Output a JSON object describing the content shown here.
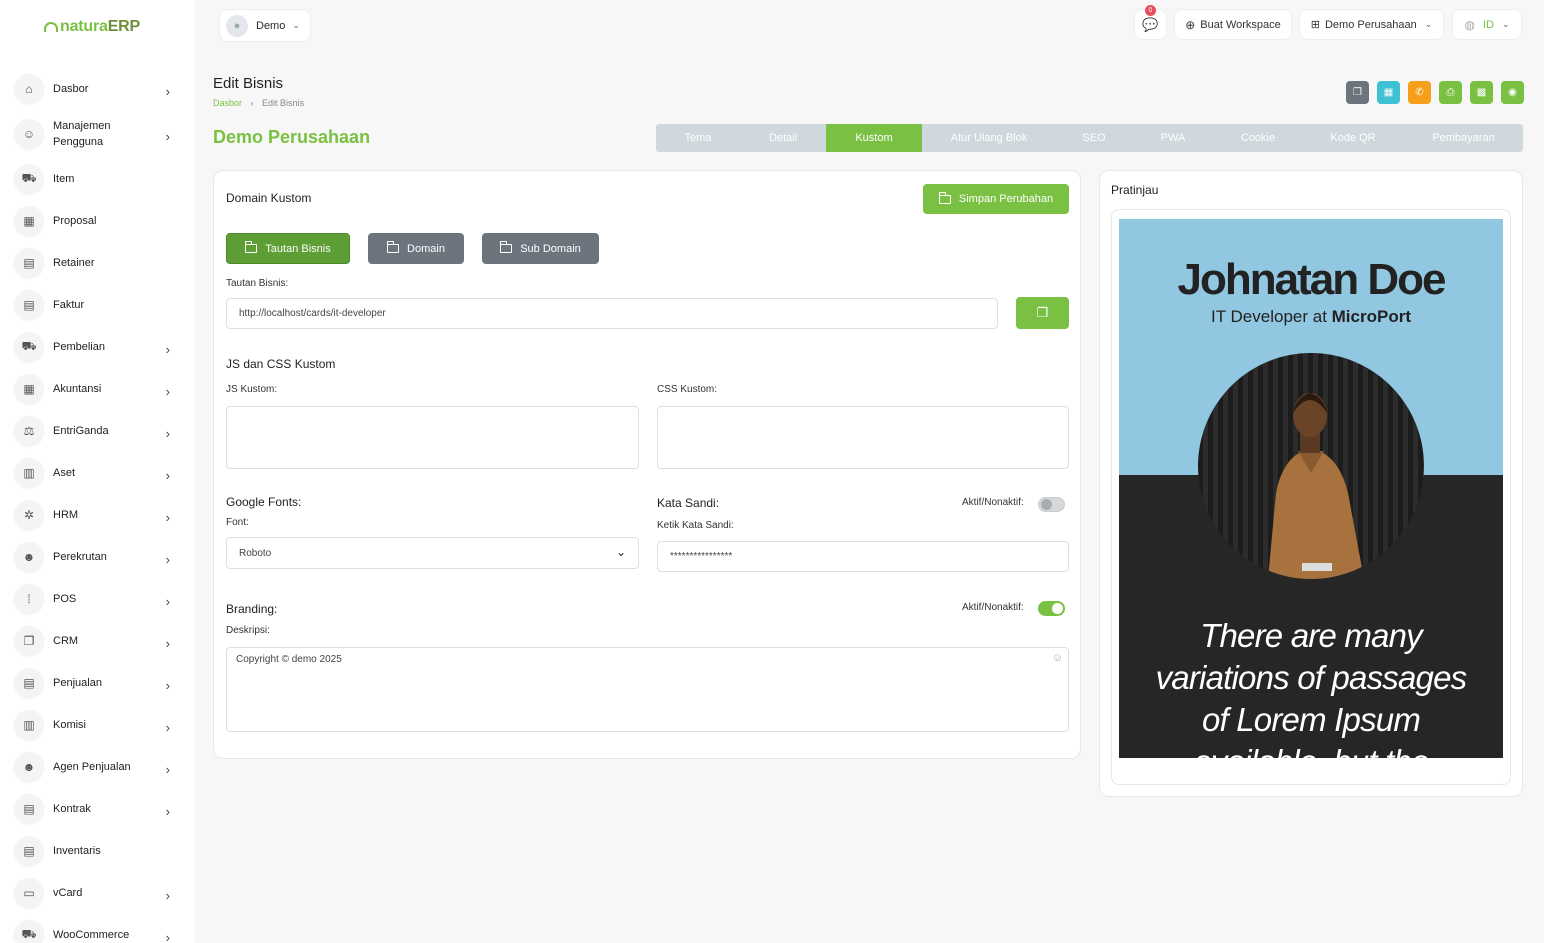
{
  "brand": {
    "name_a": "natura",
    "name_b": "ERP",
    "accent": "#7ac143"
  },
  "sidebar": {
    "items": [
      {
        "label": "Dasbor",
        "icon": "home-icon",
        "glyph": "⌂",
        "chevron": true
      },
      {
        "label": "Manajemen\nPengguna",
        "icon": "users-icon",
        "glyph": "☺",
        "chevron": true
      },
      {
        "label": "Item",
        "icon": "cart-icon",
        "glyph": "⛟",
        "chevron": false
      },
      {
        "label": "Proposal",
        "icon": "grid-icon",
        "glyph": "▦",
        "chevron": false
      },
      {
        "label": "Retainer",
        "icon": "document-icon",
        "glyph": "▤",
        "chevron": false
      },
      {
        "label": "Faktur",
        "icon": "document-icon",
        "glyph": "▤",
        "chevron": false
      },
      {
        "label": "Pembelian",
        "icon": "cart-icon",
        "glyph": "⛟",
        "chevron": true
      },
      {
        "label": "Akuntansi",
        "icon": "grid-icon",
        "glyph": "▦",
        "chevron": true
      },
      {
        "label": "EntriGanda",
        "icon": "scale-icon",
        "glyph": "⚖",
        "chevron": true
      },
      {
        "label": "Aset",
        "icon": "calculator-icon",
        "glyph": "▥",
        "chevron": true
      },
      {
        "label": "HRM",
        "icon": "settings-icon",
        "glyph": "✲",
        "chevron": true
      },
      {
        "label": "Perekrutan",
        "icon": "user-plus-icon",
        "glyph": "☻",
        "chevron": true
      },
      {
        "label": "POS",
        "icon": "dots-grid-icon",
        "glyph": "⁞",
        "chevron": true
      },
      {
        "label": "CRM",
        "icon": "copy-icon",
        "glyph": "❐",
        "chevron": true
      },
      {
        "label": "Penjualan",
        "icon": "document-icon",
        "glyph": "▤",
        "chevron": true
      },
      {
        "label": "Komisi",
        "icon": "calculator-icon",
        "glyph": "▥",
        "chevron": true
      },
      {
        "label": "Agen Penjualan",
        "icon": "user-check-icon",
        "glyph": "☻",
        "chevron": true
      },
      {
        "label": "Kontrak",
        "icon": "document-icon",
        "glyph": "▤",
        "chevron": true
      },
      {
        "label": "Inventaris",
        "icon": "document-icon",
        "glyph": "▤",
        "chevron": false
      },
      {
        "label": "vCard",
        "icon": "card-icon",
        "glyph": "▭",
        "chevron": true
      },
      {
        "label": "WooCommerce",
        "icon": "cart-icon",
        "glyph": "⛟",
        "chevron": true
      }
    ]
  },
  "topbar": {
    "user": "Demo",
    "notif_count": "0",
    "create_workspace": "Buat Workspace",
    "company": "Demo Perusahaan",
    "language": "ID"
  },
  "page": {
    "title": "Edit Bisnis",
    "breadcrumb_home": "Dasbor",
    "breadcrumb_sep": "›",
    "breadcrumb_current": "Edit Bisnis",
    "company_title": "Demo Perusahaan"
  },
  "actions": [
    {
      "name": "copy-action-button",
      "glyph": "❐",
      "color": "#6c757d"
    },
    {
      "name": "calendar-action-button",
      "glyph": "▦",
      "color": "#3ec1d3"
    },
    {
      "name": "phone-action-button",
      "glyph": "✆",
      "color": "#f59f1b"
    },
    {
      "name": "print-action-button",
      "glyph": "⎙",
      "color": "#7ac143"
    },
    {
      "name": "qr-action-button",
      "glyph": "▩",
      "color": "#7ac143"
    },
    {
      "name": "view-action-button",
      "glyph": "◉",
      "color": "#7ac143"
    }
  ],
  "tabs": [
    "Tema",
    "Detail",
    "Kustom",
    "Atur Ulang Blok",
    "SEO",
    "PWA",
    "Cookie",
    "Kode QR",
    "Pembayaran"
  ],
  "active_tab": "Kustom",
  "form": {
    "domain_heading": "Domain Kustom",
    "save_label": "Simpan Perubahan",
    "domain_buttons": [
      "Tautan Bisnis",
      "Domain",
      "Sub Domain"
    ],
    "link_label": "Tautan Bisnis:",
    "link_value": "http://localhost/cards/it-developer",
    "jscss_heading": "JS dan CSS Kustom",
    "js_label": "JS Kustom:",
    "css_label": "CSS Kustom:",
    "fonts_heading": "Google Fonts:",
    "font_label": "Font:",
    "font_value": "Roboto",
    "password_heading": "Kata Sandi:",
    "password_toggle_label": "Aktif/Nonaktif:",
    "password_toggle_on": false,
    "password_field_label": "Ketik Kata Sandi:",
    "password_value": "****************",
    "branding_heading": "Branding:",
    "branding_toggle_label": "Aktif/Nonaktif:",
    "branding_toggle_on": true,
    "description_label": "Deskripsi:",
    "description_value": "Copyright © demo 2025"
  },
  "preview": {
    "heading": "Pratinjau",
    "name": "Johnatan Doe",
    "role_prefix": "IT Developer at ",
    "role_company": "MicroPort",
    "quote_lines": [
      "There are many",
      "variations of passages",
      "of Lorem Ipsum",
      "available, but the"
    ]
  }
}
